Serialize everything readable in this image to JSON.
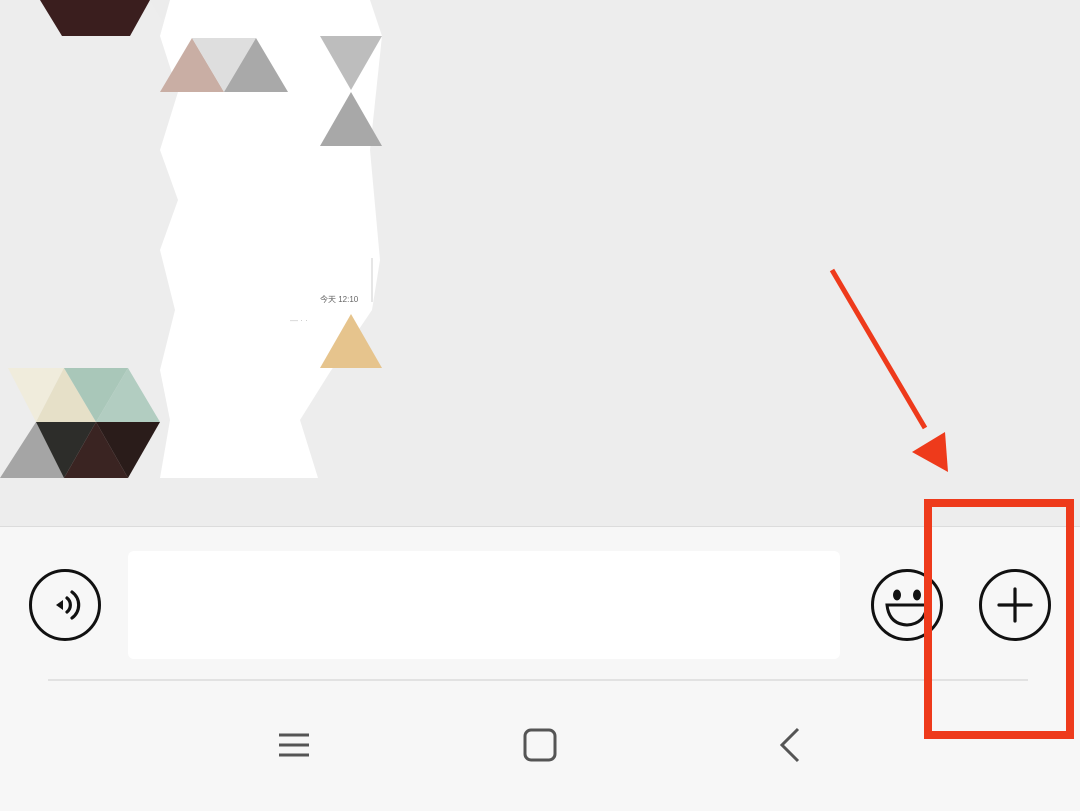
{
  "chat": {
    "timestamp": "今天 12:10",
    "timestamp_sub": "— · ·"
  },
  "input_bar": {
    "voice_icon": "voice-icon",
    "text_value": "",
    "text_placeholder": "",
    "emoji_icon": "smiley-icon",
    "more_icon": "plus-circle-icon"
  },
  "nav_bar": {
    "items": [
      "menu-icon",
      "home-icon",
      "back-icon"
    ]
  },
  "annotation": {
    "color": "#ee3a1b",
    "highlight_target": "more-button"
  }
}
